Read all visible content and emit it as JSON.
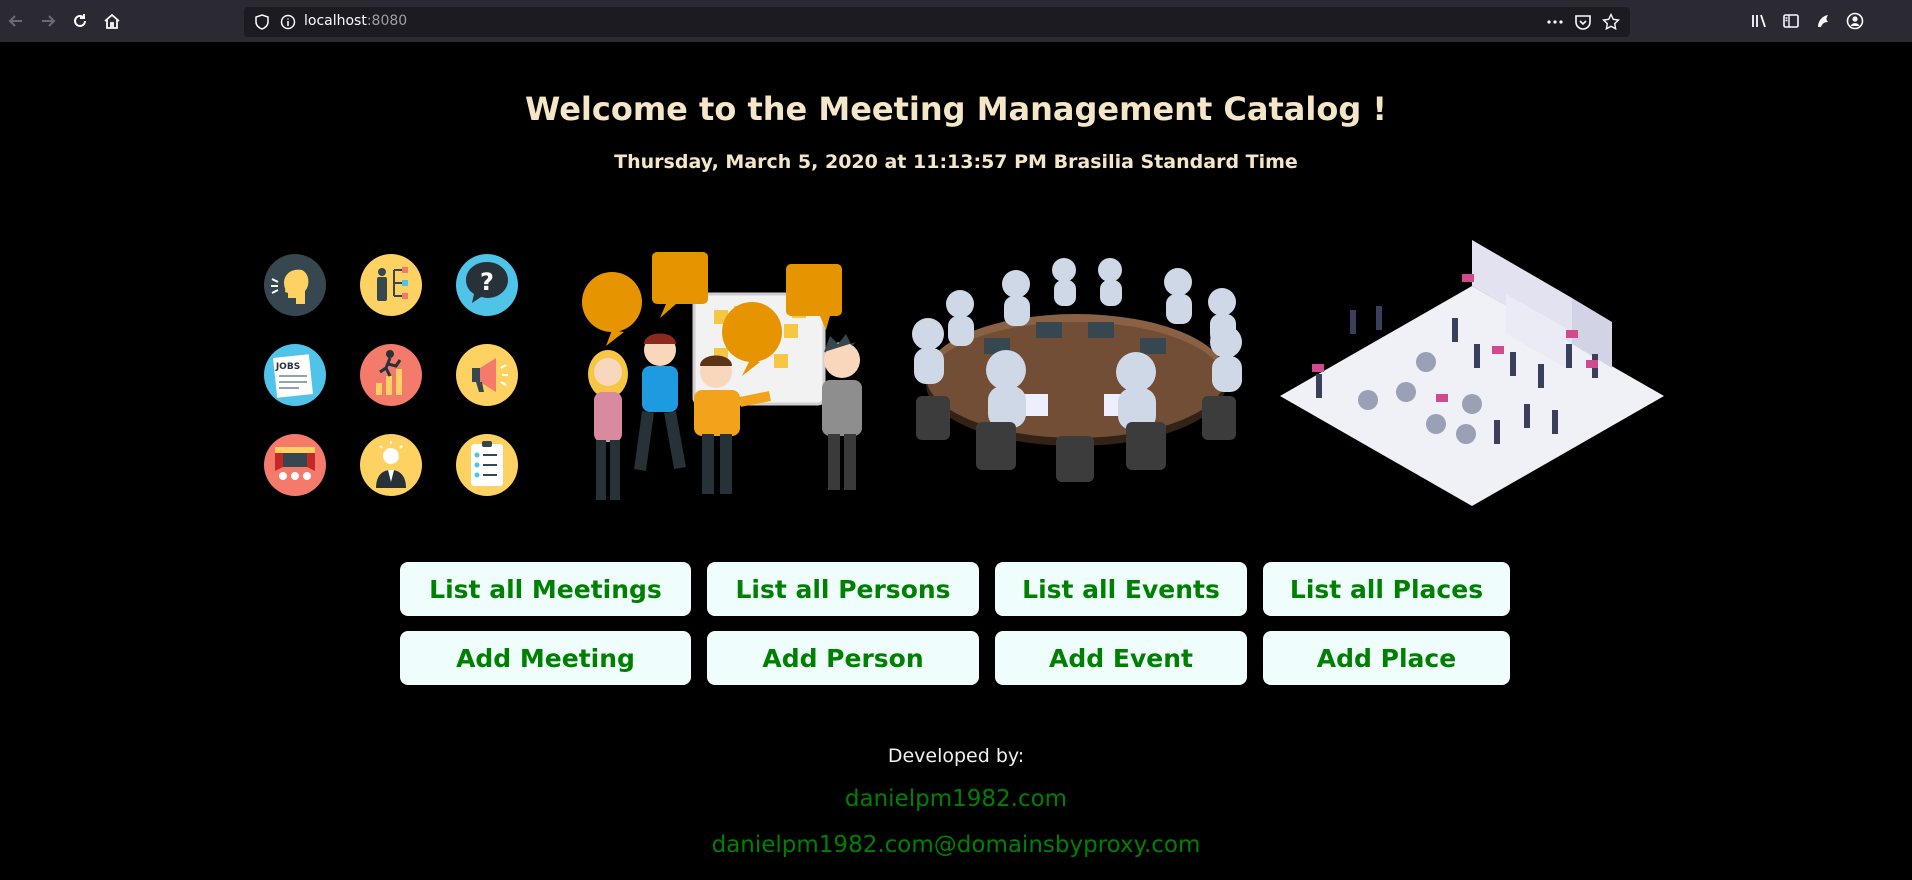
{
  "browser": {
    "url_host": "localhost",
    "url_port": ":8080"
  },
  "page": {
    "title": "Welcome to the Meeting Management Catalog !",
    "datetime": "Thursday, March 5, 2020 at 11:13:57 PM Brasilia Standard Time"
  },
  "icons": {
    "grid": [
      {
        "name": "speaking-head",
        "color": "#37474f"
      },
      {
        "name": "org-chart",
        "color": "#fdd262"
      },
      {
        "name": "question-mark",
        "color": "#4fc3e8"
      },
      {
        "name": "jobs-newspaper",
        "color": "#4fc3e8"
      },
      {
        "name": "growth-chart",
        "color": "#f47a6b"
      },
      {
        "name": "megaphone",
        "color": "#fdd262"
      },
      {
        "name": "theater-stage",
        "color": "#f47a6b"
      },
      {
        "name": "idea-person",
        "color": "#fdd262"
      },
      {
        "name": "checklist",
        "color": "#fdd262"
      }
    ],
    "speech_bubble_jobs_text": "JOBS"
  },
  "buttons": {
    "list_meetings": "List all Meetings",
    "list_persons": "List all Persons",
    "list_events": "List all Events",
    "list_places": "List all Places",
    "add_meeting": "Add Meeting",
    "add_person": "Add Person",
    "add_event": "Add Event",
    "add_place": "Add Place"
  },
  "footer": {
    "developed_by": "Developed by:",
    "site": "danielpm1982.com",
    "email": "danielpm1982.com@domainsbyproxy.com"
  },
  "colors": {
    "background": "#000000",
    "title": "#f5e6c8",
    "button_bg": "#effdfc",
    "button_text": "#008000",
    "link": "#008000"
  }
}
